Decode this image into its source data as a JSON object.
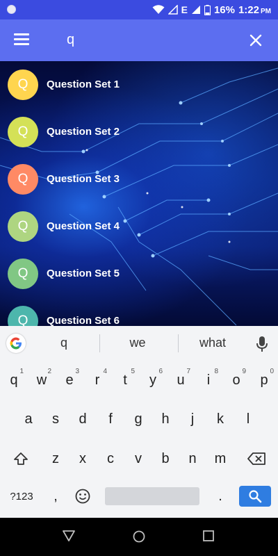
{
  "status_bar": {
    "signal_label": "E",
    "battery": "16%",
    "time": "1:22",
    "ampm": "PM"
  },
  "app_bar": {
    "search_text": "q"
  },
  "list": {
    "items": [
      {
        "avatar_letter": "Q",
        "label": "Question Set 1",
        "color": "#ffd54f"
      },
      {
        "avatar_letter": "Q",
        "label": "Question Set 2",
        "color": "#d4e157"
      },
      {
        "avatar_letter": "Q",
        "label": "Question Set 3",
        "color": "#ff8a65"
      },
      {
        "avatar_letter": "Q",
        "label": "Question Set 4",
        "color": "#aed581"
      },
      {
        "avatar_letter": "Q",
        "label": "Question Set 5",
        "color": "#81c784"
      },
      {
        "avatar_letter": "Q",
        "label": "Question Set 6",
        "color": "#4db6ac"
      }
    ]
  },
  "suggestions": [
    "q",
    "we",
    "what"
  ],
  "keyboard": {
    "row1": [
      {
        "key": "q",
        "hint": "1"
      },
      {
        "key": "w",
        "hint": "2"
      },
      {
        "key": "e",
        "hint": "3"
      },
      {
        "key": "r",
        "hint": "4"
      },
      {
        "key": "t",
        "hint": "5"
      },
      {
        "key": "y",
        "hint": "6"
      },
      {
        "key": "u",
        "hint": "7"
      },
      {
        "key": "i",
        "hint": "8"
      },
      {
        "key": "o",
        "hint": "9"
      },
      {
        "key": "p",
        "hint": "0"
      }
    ],
    "row2": [
      "a",
      "s",
      "d",
      "f",
      "g",
      "h",
      "j",
      "k",
      "l"
    ],
    "row3": [
      "z",
      "x",
      "c",
      "v",
      "b",
      "n",
      "m"
    ],
    "symbols_label": "?123",
    "comma": ",",
    "period": "."
  },
  "colors": {
    "status_bar": "#3b4be0",
    "app_bar": "#5c6ef0",
    "enter_key": "#2f7de1"
  }
}
